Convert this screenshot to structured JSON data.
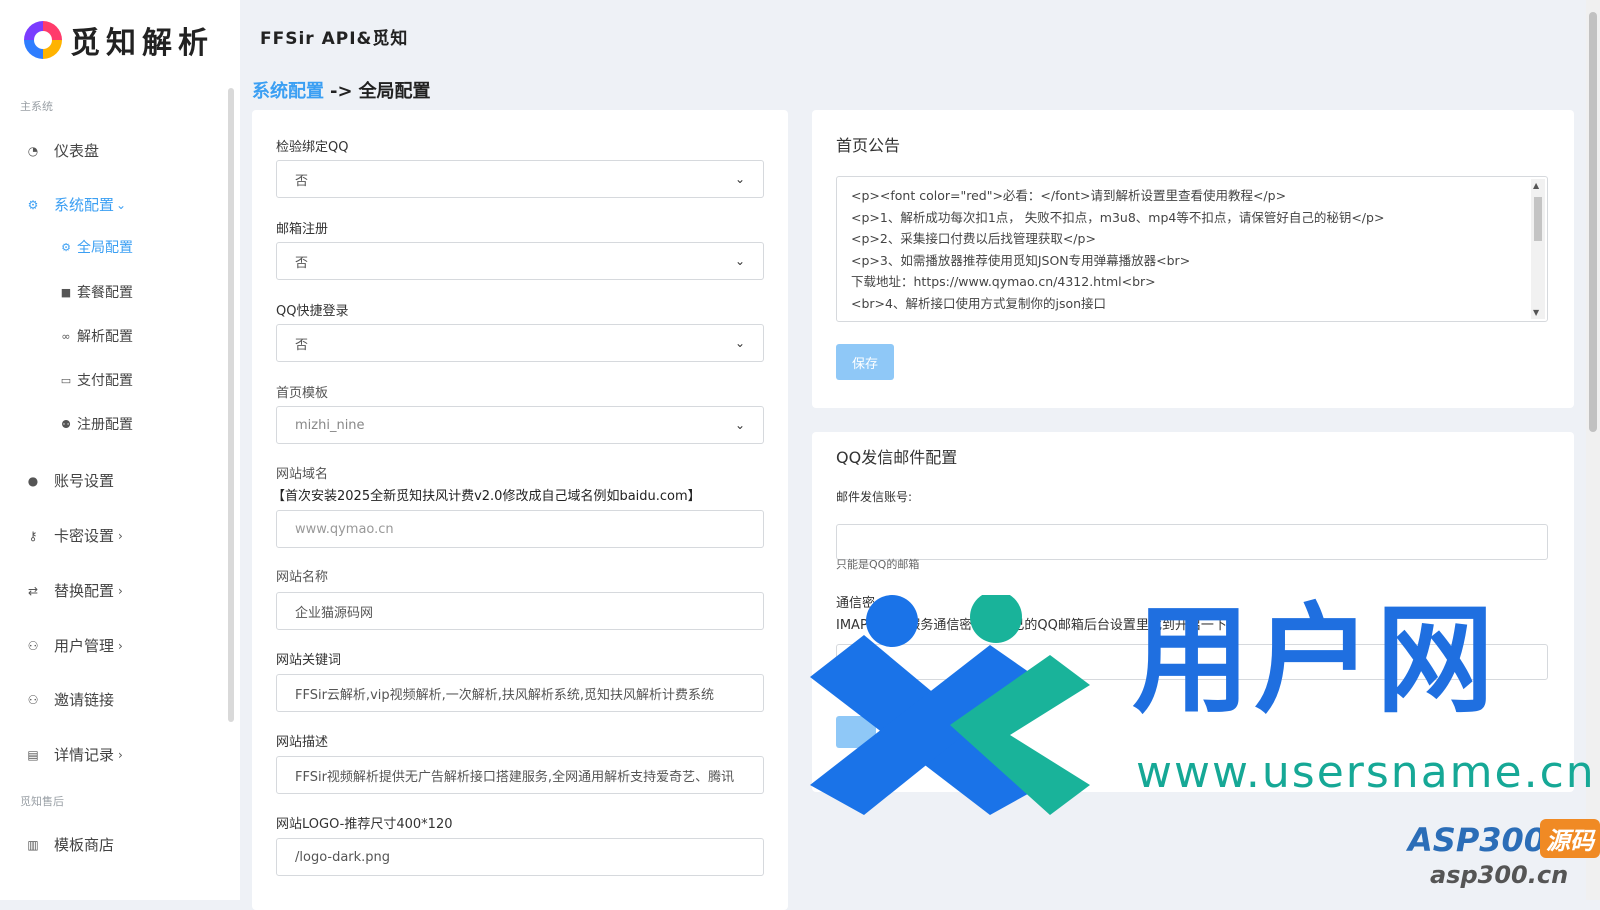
{
  "brand": {
    "logo_text": "觅知解析"
  },
  "app_title": "FFSir API&觅知",
  "breadcrumb": {
    "parent": "系统配置",
    "separator": "->",
    "current": "全局配置"
  },
  "sidebar": {
    "section_main": "主系统",
    "section_after": "觅知售后",
    "dashboard": "仪表盘",
    "system_config": "系统配置",
    "sub": {
      "global": "全局配置",
      "package": "套餐配置",
      "parse": "解析配置",
      "payment": "支付配置",
      "register": "注册配置"
    },
    "account": "账号设置",
    "cardkey": "卡密设置",
    "replace": "替换配置",
    "users": "用户管理",
    "invite": "邀请链接",
    "records": "详情记录",
    "template_store": "模板商店"
  },
  "form": {
    "qq_bind_label": "检验绑定QQ",
    "qq_bind_value": "否",
    "email_reg_label": "邮箱注册",
    "email_reg_value": "否",
    "qq_login_label": "QQ快捷登录",
    "qq_login_value": "否",
    "template_label": "首页模板",
    "template_value": "mizhi_nine",
    "domain_label": "网站域名",
    "domain_hint": "【首次安装2025全新觅知扶风计费v2.0修改成自己域名例如baidu.com】",
    "domain_placeholder": "www.qymao.cn",
    "site_name_label": "网站名称",
    "site_name_value": "企业猫源码网",
    "keywords_label": "网站关键词",
    "keywords_value": "FFSir云解析,vip视频解析,一次解析,扶风解析系统,觅知扶风解析计费系统",
    "desc_label": "网站描述",
    "desc_value": "FFSir视频解析提供无广告解析接口搭建服务,全网通用解析支持爱奇艺、腾讯",
    "logo_label": "网站LOGO-推荐尺寸400*120",
    "logo_value": "/logo-dark.png"
  },
  "notice": {
    "title": "首页公告",
    "lines": [
      "<p><font color=\"red\">必看：</font>请到解析设置里查看使用教程</p>",
      "<p>1、解析成功每次扣1点， 失败不扣点，m3u8、mp4等不扣点，请保管好自己的秘钥</p>",
      "<p>2、采集接口付费以后找管理获取</p>",
      "<p>3、如需播放器推荐使用觅知JSON专用弹幕播放器<br>",
      "下载地址：https://www.qymao.cn/4312.html<br>",
      "<br>4、解析接口使用方式复制你的json接口"
    ],
    "save_label": "保存"
  },
  "mail": {
    "title": "QQ发信邮件配置",
    "account_label": "邮件发信账号:",
    "account_hint": "只能是QQ的邮箱",
    "secret_label": "通信密",
    "secret_hint": "IMAP/SMTP服务通信密码，自己的QQ邮箱后台设置里找到开启一下"
  },
  "watermark": {
    "text": "用户网",
    "url": "www.usersname.cn",
    "asp": "ASP300",
    "yuanma": "源码",
    "asp_url": "asp300.cn"
  }
}
